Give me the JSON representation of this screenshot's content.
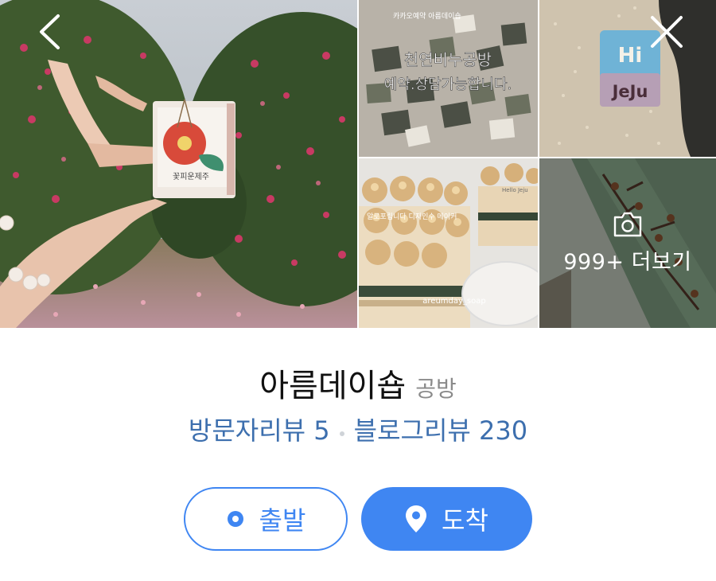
{
  "gallery": {
    "photos": [
      {
        "subject": "hand holding camellia soap box in front of camellia hedges"
      },
      {
        "subject": "soap collection photo",
        "watermark": "카카오예약 아름데이숍",
        "caption_line1": "천연비누공방",
        "caption_line2": "예약.상담가능합니다."
      },
      {
        "subject": "Hi Jeju soap on sand",
        "soap_text_1": "Hi",
        "soap_text_2": "JeJu"
      },
      {
        "subject": "cream topped soap cakes",
        "overlay_text": "알로포립니다 디자인수 메이커",
        "watermark": "areumday_soap",
        "tag_text": "Hello Jeju"
      },
      {
        "subject": "soap loaf with flower branch pattern"
      }
    ],
    "more_label": "999+ 더보기"
  },
  "nav": {
    "back_icon": "chevron-left-icon",
    "close_icon": "close-icon"
  },
  "place": {
    "name": "아름데이숍",
    "category": "공방"
  },
  "reviews": {
    "visitor_label": "방문자리뷰 5",
    "blog_label": "블로그리뷰 230"
  },
  "actions": {
    "start_label": "출발",
    "arrive_label": "도착"
  },
  "colors": {
    "accent": "#3f86f2",
    "review_link": "#3d6fae",
    "title": "#111111",
    "category": "#8a8a8a"
  }
}
